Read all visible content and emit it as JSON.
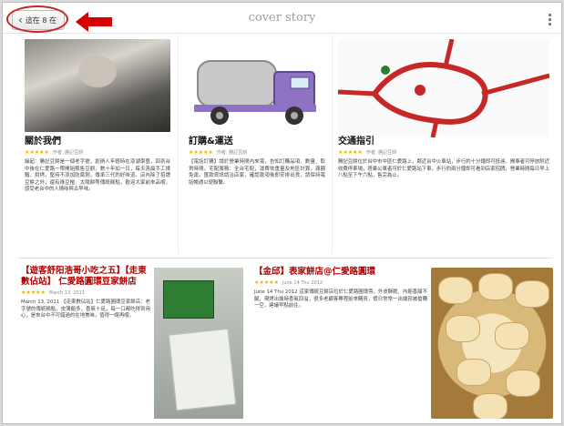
{
  "header": {
    "title": "cover story",
    "back_label": "這在 8 在",
    "annotation_color": "#c62828"
  },
  "cards": [
    {
      "title": "關於我們",
      "meta": "作者: 勝記豆餅",
      "body": "緣起：勝記豆餅是一個老字號，創辦人年輕時在澎湖學藝，回到台中後在仁愛路一帶開始販售豆餅，數十年如一日，每天清晨手工揉麵、烘烤，堅持不添加防腐劑，傳承三代的好味道。店內除了招牌豆餅之外，還有綠豆椪、太陽餅等傳統糕點，歡迎大家前來品嚐，感受老台中的人情味與古早味。"
    },
    {
      "title": "訂購&運送",
      "meta": "作者: 勝記豆餅",
      "body": "【電話訂購】請於營業時間內來電，告知訂購品項、數量、取貨時間。宅配服務：全台宅配，運費依重量及地區計算，滿額免運。匯款資訊請洽店家，確認款項後即安排出貨，請保持電話暢通以便聯繫。"
    },
    {
      "title": "交通指引",
      "meta": "作者: 勝記豆餅",
      "body": "勝記豆餅位於台中市中區仁愛路上，鄰近台中火車站，步行約十分鐘即可抵達。開車者可停放附近收費停車場，搭乘公車者可於仁愛路站下車，步行約兩分鐘即可看到店家招牌，營業時間每日早上八點至下午六點，售完為止。"
    },
    {
      "title": "【遊客舒阳浩哥小吃之五】【走東數佔站】 仁愛路圓環豆家餅店",
      "meta": "March 13, 2011",
      "body": "March 13, 2011 【走東數佔站】仁愛路圓環豆家餅店：老字號的傳統糕點，皮薄餡多，香氣十足，每一口都吃得到用心，是來台中不可錯過的在地美味，值得一嚐再嚐。"
    },
    {
      "title": "【金邱】表家餅店@仁愛路圓環",
      "meta": "June 14 Thu 2012",
      "body": "June 14 Thu 2012 這家傳統豆餅店位於仁愛路圓環旁，外皮酥脆、內餡香甜不膩，現烤出爐時香氣四溢，很多老顧客專程前來購買，假日常常一出爐就被搶購一空，建議早點前往。"
    }
  ],
  "images": {
    "truck_color": "#8e73c4",
    "map_color": "#c62828",
    "book_color": "#2e7d32"
  }
}
